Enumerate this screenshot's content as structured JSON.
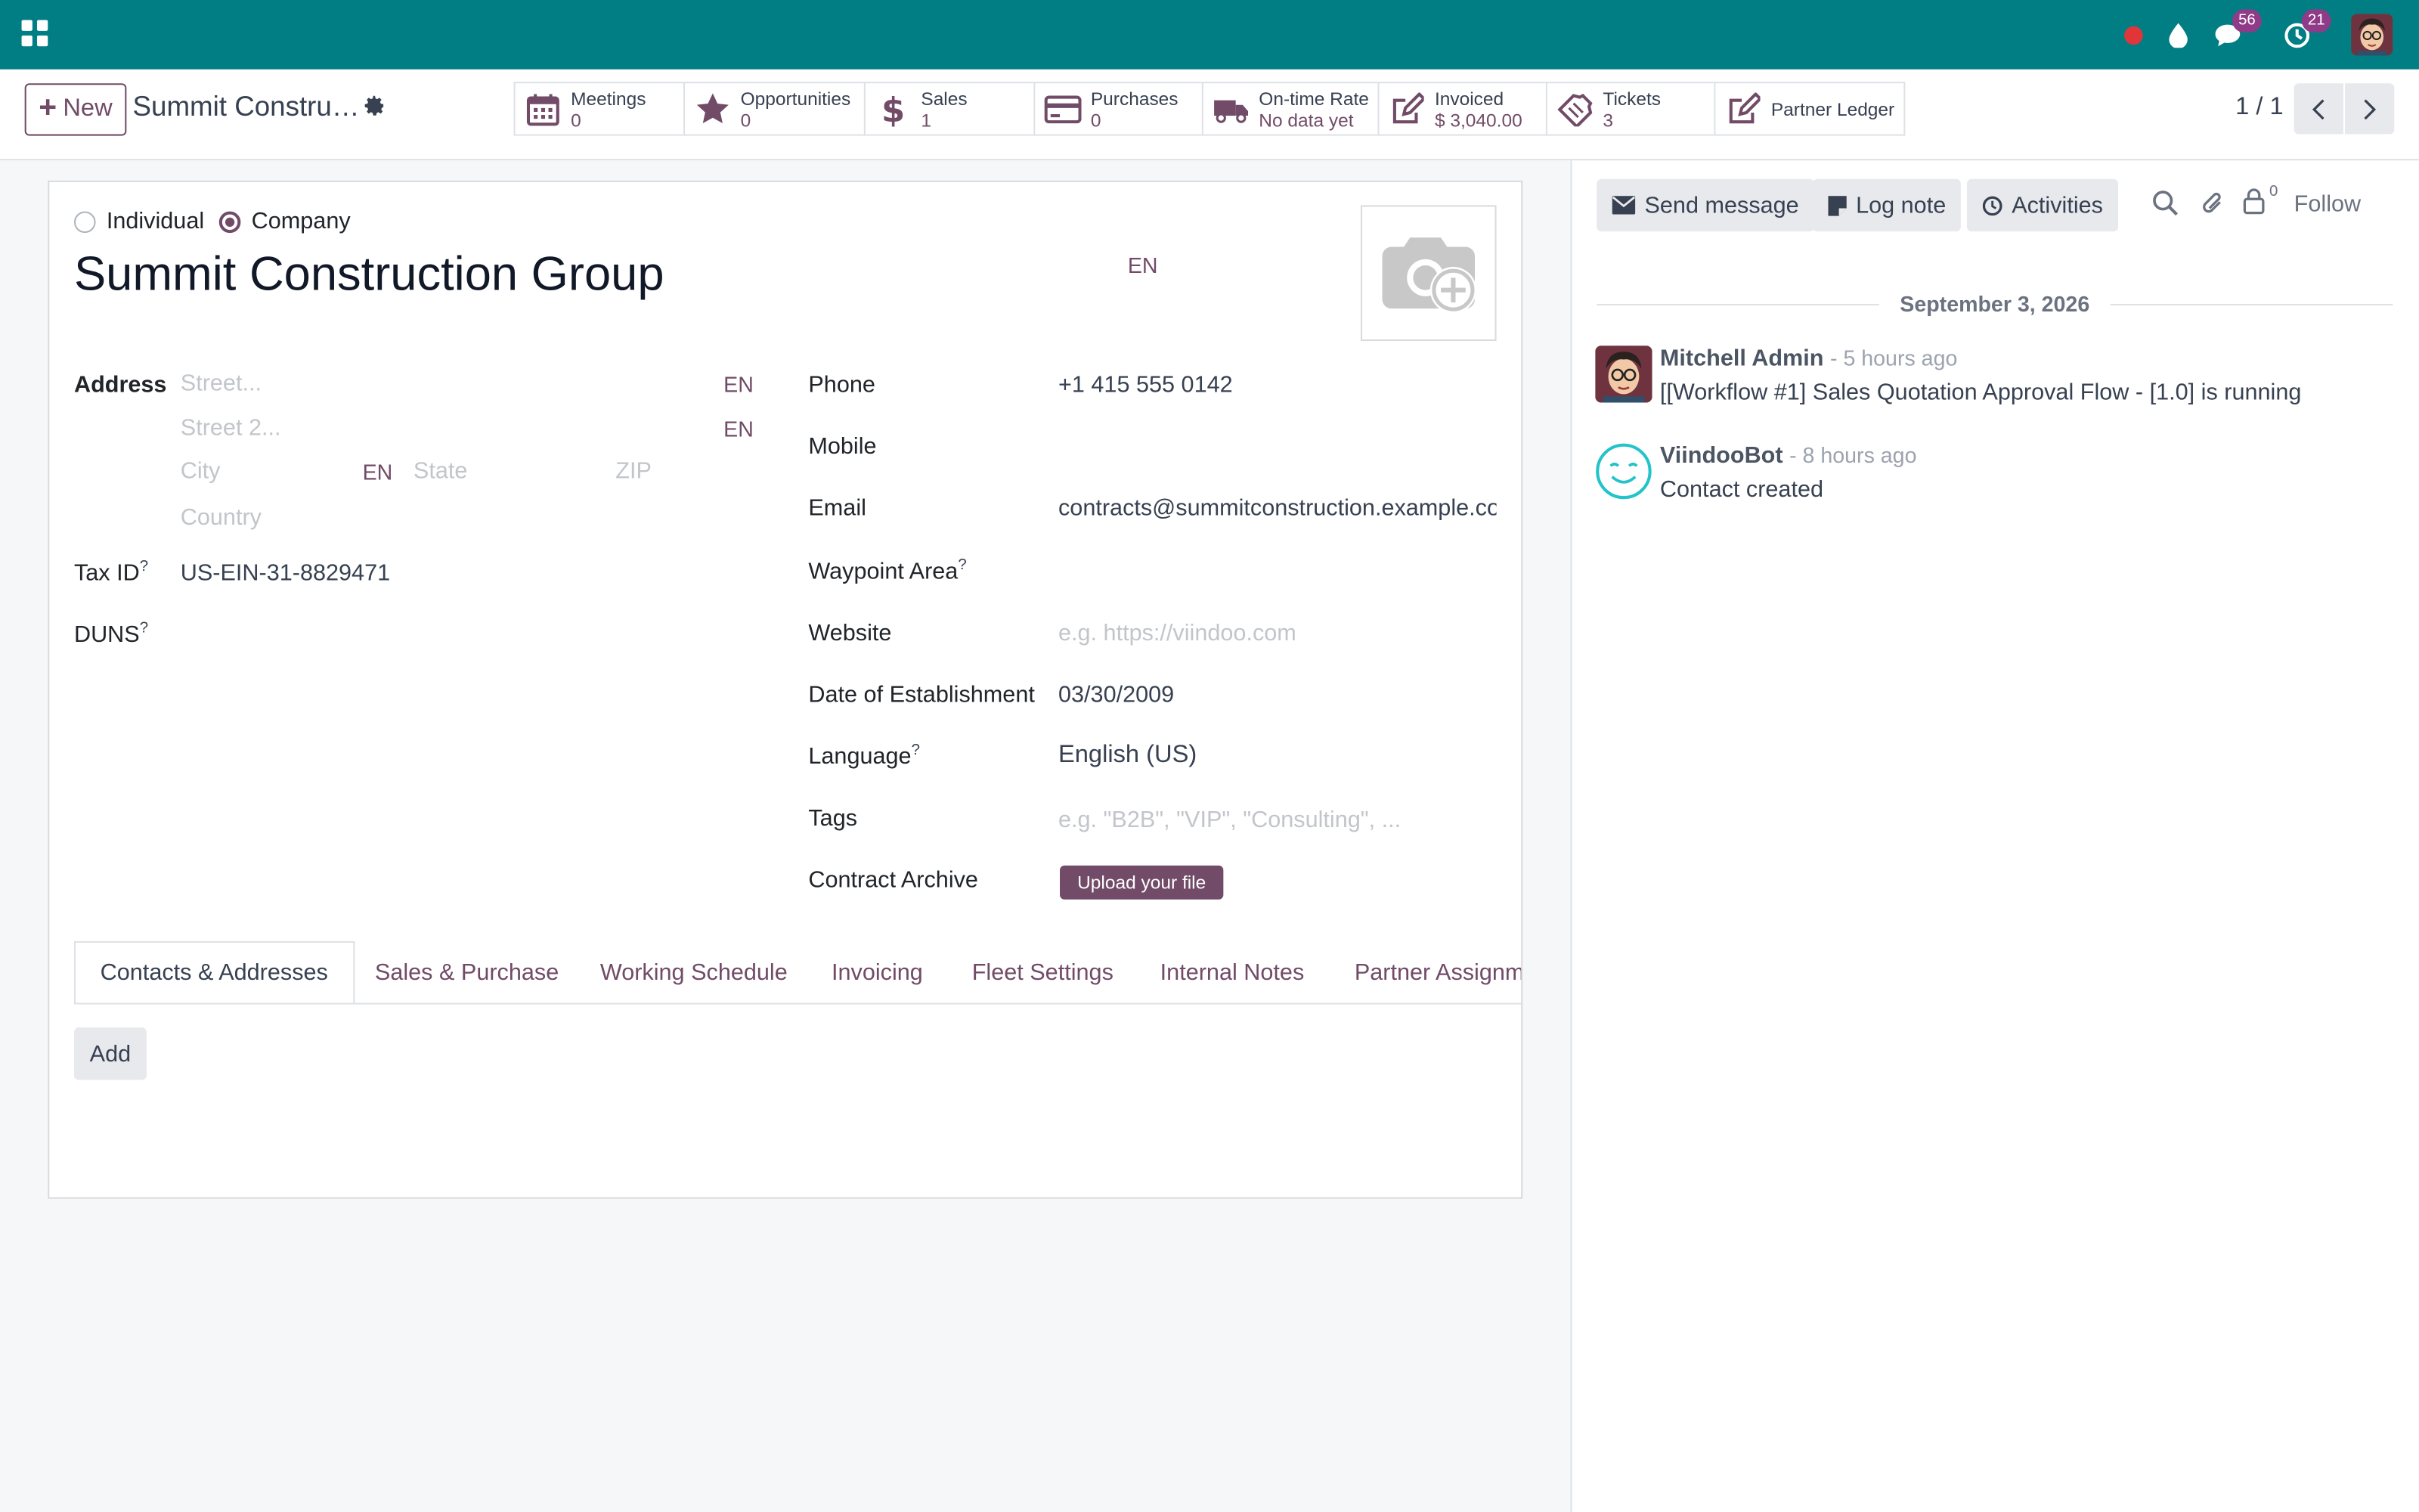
{
  "navbar": {
    "chat_badge": "56",
    "activity_badge": "21"
  },
  "control_panel": {
    "new_label": "New",
    "record_title": "Summit Constru…",
    "pager": "1 / 1",
    "smart_buttons": [
      {
        "label": "Meetings",
        "value": "0",
        "icon": "calendar-icon"
      },
      {
        "label": "Opportunities",
        "value": "0",
        "icon": "star-icon"
      },
      {
        "label": "Sales",
        "value": "1",
        "icon": "dollar-icon"
      },
      {
        "label": "Purchases",
        "value": "0",
        "icon": "credit-card-icon"
      },
      {
        "label": "On-time Rate",
        "value": "No data yet",
        "icon": "truck-icon"
      },
      {
        "label": "Invoiced",
        "value": "$ 3,040.00",
        "icon": "pencil-square-icon"
      },
      {
        "label": "Tickets",
        "value": "3",
        "icon": "ticket-icon"
      },
      {
        "label": "Partner Ledger",
        "value": "",
        "icon": "pencil-square-icon"
      }
    ]
  },
  "form": {
    "type_options": [
      "Individual",
      "Company"
    ],
    "type_selected": "Company",
    "name": "Summit Construction Group",
    "lang_tag": "EN",
    "address_label": "Address",
    "street_placeholder": "Street...",
    "street2_placeholder": "Street 2...",
    "city_placeholder": "City",
    "state_placeholder": "State",
    "zip_placeholder": "ZIP",
    "country_placeholder": "Country",
    "tax_id_label": "Tax ID",
    "tax_id_value": "US-EIN-31-8829471",
    "duns_label": "DUNS",
    "help_mark": "?",
    "phone_label": "Phone",
    "phone_value": "+1 415 555 0142",
    "mobile_label": "Mobile",
    "email_label": "Email",
    "email_value": "contracts@summitconstruction.example.com",
    "waypoint_label": "Waypoint Area",
    "website_label": "Website",
    "website_placeholder": "e.g. https://viindoo.com",
    "doe_label": "Date of Establishment",
    "doe_value": "03/30/2009",
    "language_label": "Language",
    "language_value": "English (US)",
    "tags_label": "Tags",
    "tags_placeholder": "e.g. \"B2B\", \"VIP\", \"Consulting\", ...",
    "contract_label": "Contract Archive",
    "upload_label": "Upload your file"
  },
  "tabs": [
    "Contacts & Addresses",
    "Sales & Purchase",
    "Working Schedule",
    "Invoicing",
    "Fleet Settings",
    "Internal Notes",
    "Partner Assignm"
  ],
  "add_label": "Add",
  "chatter": {
    "send_message": "Send message",
    "log_note": "Log note",
    "activities": "Activities",
    "followers_count": "0",
    "follow": "Follow",
    "date": "September 3, 2026",
    "messages": [
      {
        "author": "Mitchell Admin",
        "time": "- 5 hours ago",
        "body": "[[Workflow #1] Sales Quotation Approval Flow - [1.0] is running"
      },
      {
        "author": "ViindooBot",
        "time": "- 8 hours ago",
        "body": "Contact created"
      }
    ]
  },
  "colors": {
    "navbar": "#017E84",
    "accent": "#714B67"
  }
}
